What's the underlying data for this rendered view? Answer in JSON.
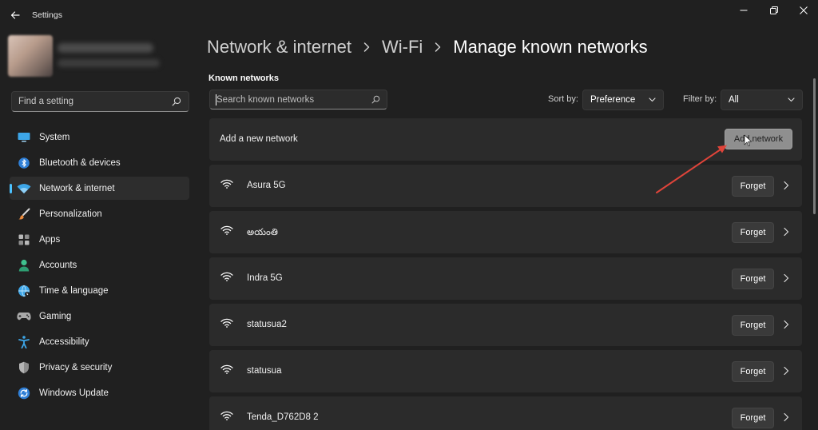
{
  "app": {
    "title": "Settings"
  },
  "sidebar": {
    "search_placeholder": "Find a setting",
    "items": [
      {
        "label": "System",
        "icon": "system-icon"
      },
      {
        "label": "Bluetooth & devices",
        "icon": "bluetooth-icon"
      },
      {
        "label": "Network & internet",
        "icon": "network-icon",
        "active": true
      },
      {
        "label": "Personalization",
        "icon": "brush-icon"
      },
      {
        "label": "Apps",
        "icon": "apps-icon"
      },
      {
        "label": "Accounts",
        "icon": "accounts-icon"
      },
      {
        "label": "Time & language",
        "icon": "globe-icon"
      },
      {
        "label": "Gaming",
        "icon": "gamepad-icon"
      },
      {
        "label": "Accessibility",
        "icon": "accessibility-icon"
      },
      {
        "label": "Privacy & security",
        "icon": "shield-icon"
      },
      {
        "label": "Windows Update",
        "icon": "update-icon"
      }
    ]
  },
  "breadcrumb": {
    "level1": "Network & internet",
    "level2": "Wi-Fi",
    "current": "Manage known networks"
  },
  "known_networks": {
    "title": "Known networks",
    "search_placeholder": "Search known networks",
    "sort_label": "Sort by:",
    "sort_value": "Preference",
    "filter_label": "Filter by:",
    "filter_value": "All",
    "add_label": "Add a new network",
    "add_button": "Add network",
    "forget_label": "Forget",
    "networks": [
      {
        "name": "Asura 5G"
      },
      {
        "name": "అయంతి"
      },
      {
        "name": "Indra 5G"
      },
      {
        "name": "statusua2"
      },
      {
        "name": "statusua"
      },
      {
        "name": "Tenda_D762D8 2"
      }
    ]
  },
  "colors": {
    "accent": "#4cc2ff",
    "annotation_arrow": "#e0443a",
    "background": "#202020",
    "card": "#2b2b2b"
  }
}
